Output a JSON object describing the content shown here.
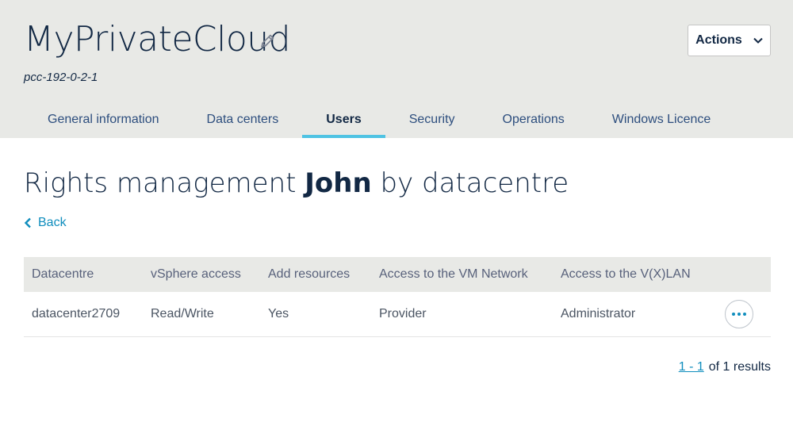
{
  "header": {
    "title": "MyPrivateCloud",
    "subtitle": "pcc-192-0-2-1",
    "actions_label": "Actions"
  },
  "tabs": [
    {
      "label": "General information"
    },
    {
      "label": "Data centers"
    },
    {
      "label": "Users",
      "active": true
    },
    {
      "label": "Security"
    },
    {
      "label": "Operations"
    },
    {
      "label": "Windows Licence"
    }
  ],
  "main": {
    "heading_prefix": "Rights management ",
    "heading_user": "John",
    "heading_suffix": " by datacentre",
    "back_label": "Back"
  },
  "table": {
    "columns": [
      "Datacentre",
      "vSphere access",
      "Add resources",
      "Access to the VM Network",
      "Access to the V(X)LAN"
    ],
    "rows": [
      [
        "datacenter2709",
        "Read/Write",
        "Yes",
        "Provider",
        "Administrator"
      ]
    ]
  },
  "pagination": {
    "range": "1 - 1",
    "text": "of 1 results"
  },
  "colors": {
    "header_bg": "#e8e9e6",
    "accent": "#4fc3e3",
    "link": "#0f8dbd",
    "title": "#122844"
  },
  "icons": [
    "pencil-icon",
    "chevron-down-icon",
    "chevron-left-icon",
    "more-horizontal-icon"
  ]
}
